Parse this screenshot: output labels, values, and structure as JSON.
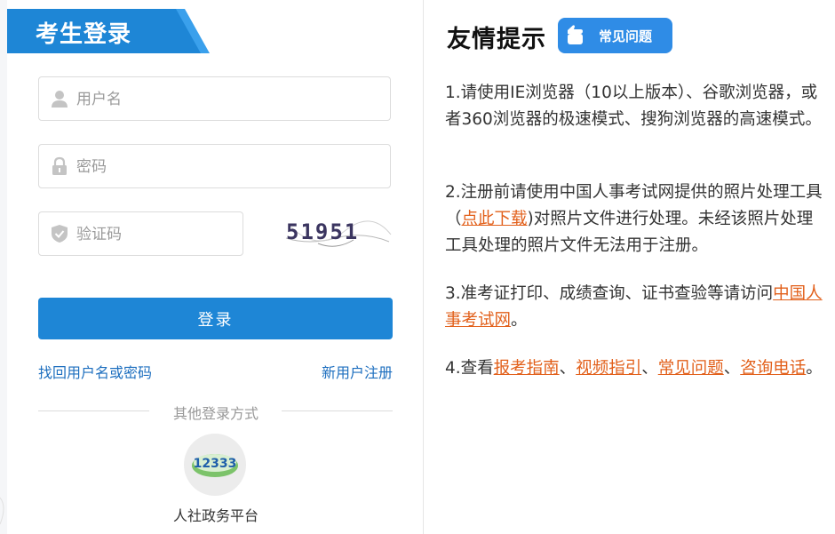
{
  "login": {
    "title": "考生登录",
    "username_placeholder": "用户名",
    "password_placeholder": "密码",
    "captcha_placeholder": "验证码",
    "captcha_text": "51951",
    "login_button": "登录",
    "forgot_link": "找回用户名或密码",
    "register_link": "新用户注册",
    "other_methods": "其他登录方式",
    "platform_logo_text": "12333",
    "platform_label": "人社政务平台"
  },
  "tips": {
    "title": "友情提示",
    "faq_badge": "常见问题",
    "tip1": "1.请使用IE浏览器（10以上版本）、谷歌浏览器，或者360浏览器的极速模式、搜狗浏览器的高速模式。",
    "tip2": {
      "before": "2.注册前请使用中国人事考试网提供的照片处理工具（",
      "link": "点此下载",
      "after": ")对照片文件进行处理。未经该照片处理工具处理的照片文件无法用于注册。"
    },
    "tip3": {
      "before": "3.准考证打印、成绩查询、证书查验等请访问",
      "link": "中国人事考试网",
      "after": "。"
    },
    "tip4": {
      "before": "4.查看",
      "link1": "报考指南",
      "sep1": "、",
      "link2": "视频指引",
      "sep2": "、",
      "link3": "常见问题",
      "sep3": "、",
      "link4": "咨询电话",
      "after": "。"
    }
  },
  "colors": {
    "primary": "#1e86d6",
    "link": "#1e6fbf",
    "accent_link": "#e2601b"
  },
  "icons": [
    "user-icon",
    "lock-icon",
    "shield-check-icon",
    "hand-pointer-icon"
  ]
}
